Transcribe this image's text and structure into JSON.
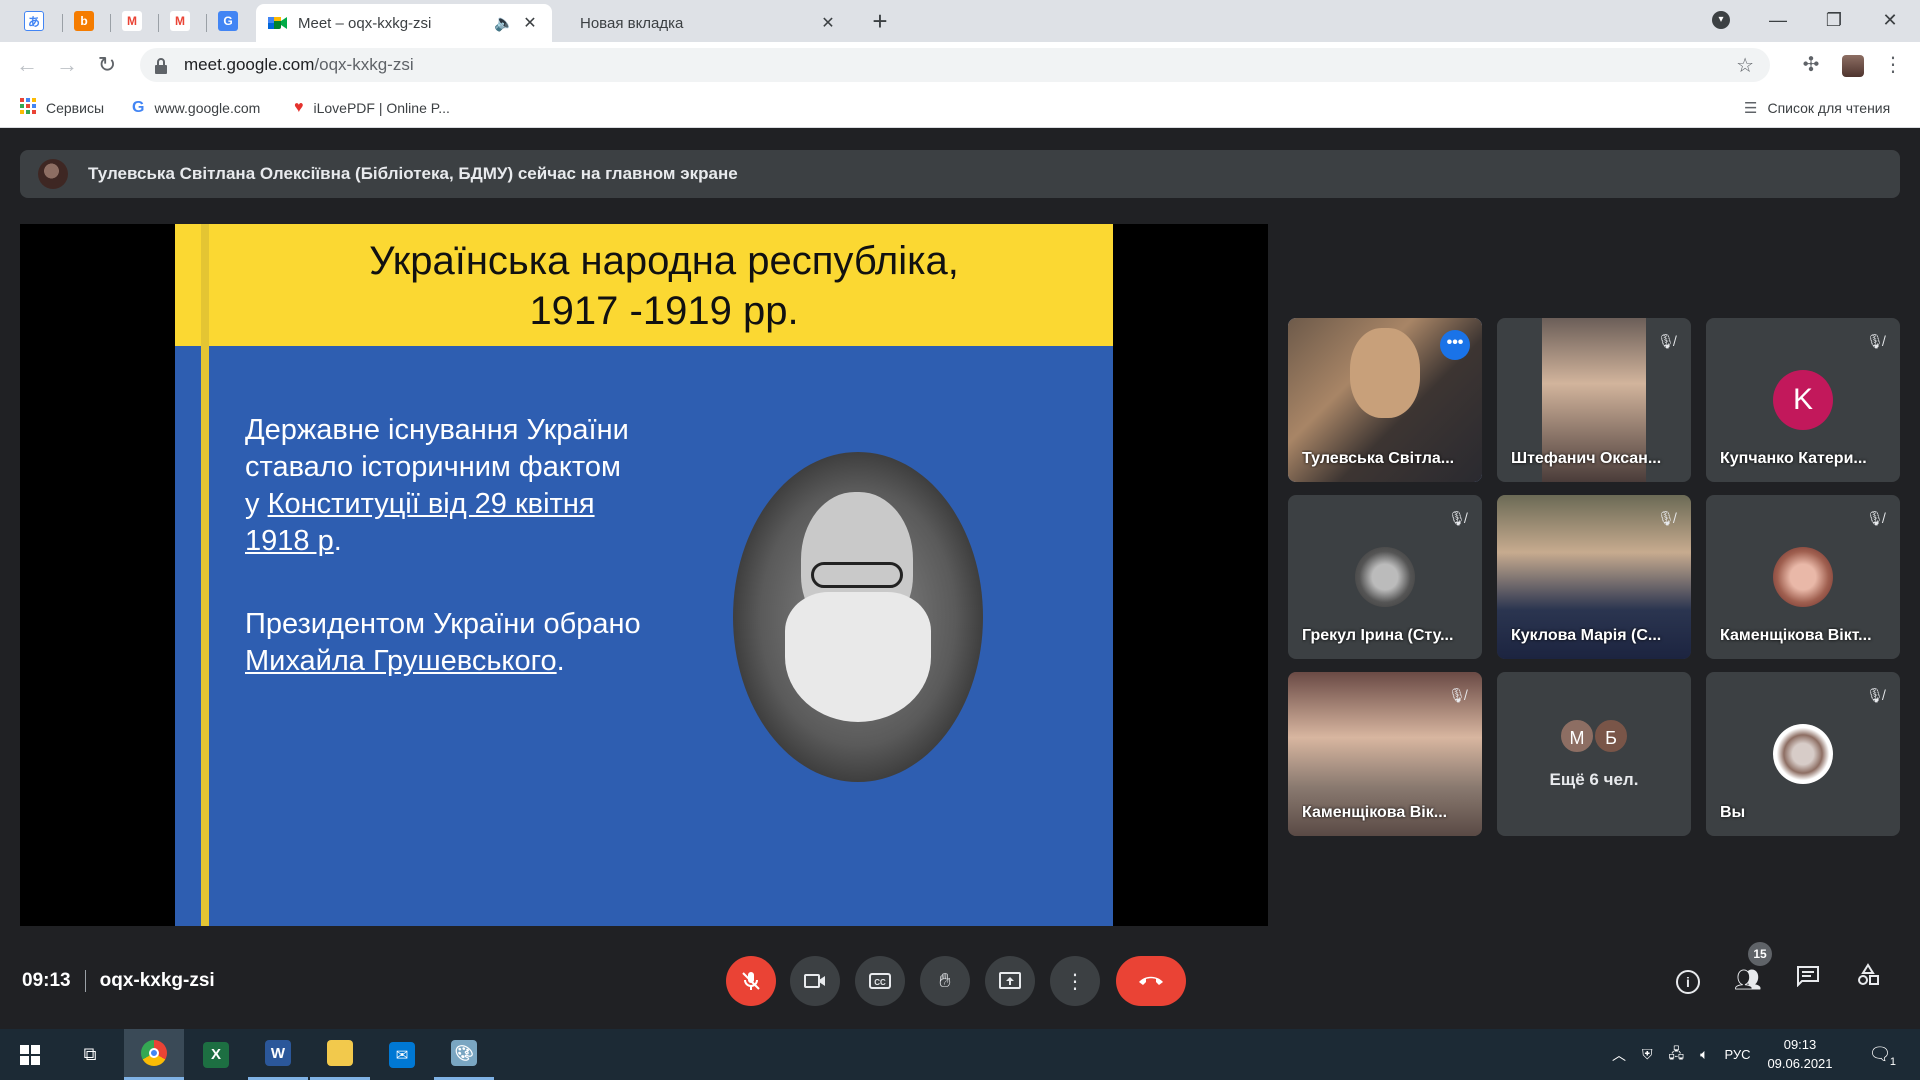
{
  "browser": {
    "pinned_tabs": [
      {
        "icon": "translate-icon",
        "glyph": "あ",
        "color": "#4285f4"
      },
      {
        "icon": "blogger-icon",
        "glyph": "b",
        "color": "#f57c00"
      },
      {
        "icon": "gmail-icon",
        "glyph": "M",
        "color": "#ea4335"
      },
      {
        "icon": "gmail-icon",
        "glyph": "M",
        "color": "#ea4335"
      },
      {
        "icon": "google-translate-icon",
        "glyph": "G",
        "color": "#4285f4"
      }
    ],
    "tabs": [
      {
        "title": "Meet – oqx-kxkg-zsi",
        "active": true
      },
      {
        "title": "Новая вкладка",
        "active": false
      }
    ],
    "url_host": "meet.google.com",
    "url_path": "/oqx-kxkg-zsi",
    "bookmarks": [
      {
        "label": "Сервисы",
        "icon": "apps-grid-icon"
      },
      {
        "label": "www.google.com",
        "icon": "google-icon"
      },
      {
        "label": "iLovePDF | Online P...",
        "icon": "ilovepdf-heart-icon"
      }
    ],
    "reading_list": "Список для чтения"
  },
  "meet": {
    "banner": "Тулевська Світлана Олексіївна (Бібліотека, БДМУ) сейчас на главном экране",
    "slide": {
      "title_line1": "Українська народна республіка,",
      "title_line2": "1917 -1919 рр.",
      "p1_line1": "Державне існування України",
      "p1_line2": "ставало історичним фактом",
      "p1_line3_prefix": "у ",
      "p1_line3_link": "Конституції від 29 квітня",
      "p1_line4_link": "1918 р",
      "p1_line4_suffix": ".",
      "p2_line1": "Президентом України обрано",
      "p2_line2_link": "Михайла Грушевського",
      "p2_line2_suffix": "."
    },
    "participants": [
      {
        "name": "Тулевська Світла...",
        "type": "video",
        "speaking": true
      },
      {
        "name": "Штефанич Оксан...",
        "type": "video",
        "muted": true
      },
      {
        "name": "Купчанко Катери...",
        "type": "initial",
        "initial": "K",
        "color": "#c2185b",
        "muted": true
      },
      {
        "name": "Грекул Ірина (Сту...",
        "type": "photo",
        "muted": true
      },
      {
        "name": "Куклова Марія (С...",
        "type": "video",
        "muted": true
      },
      {
        "name": "Каменщікова Вікт...",
        "type": "photo",
        "muted": true
      },
      {
        "name": "Каменщікова Вік...",
        "type": "video",
        "muted": true
      },
      {
        "name": "Ещё 6 чел.",
        "type": "more",
        "initials": [
          "М",
          "Б"
        ]
      },
      {
        "name": "Вы",
        "type": "photo",
        "muted": true
      }
    ],
    "time": "09:13",
    "meeting_code": "oqx-kxkg-zsi",
    "participant_count": "15"
  },
  "taskbar": {
    "language": "РУС",
    "clock_time": "09:13",
    "clock_date": "09.06.2021",
    "notifications": "1"
  }
}
